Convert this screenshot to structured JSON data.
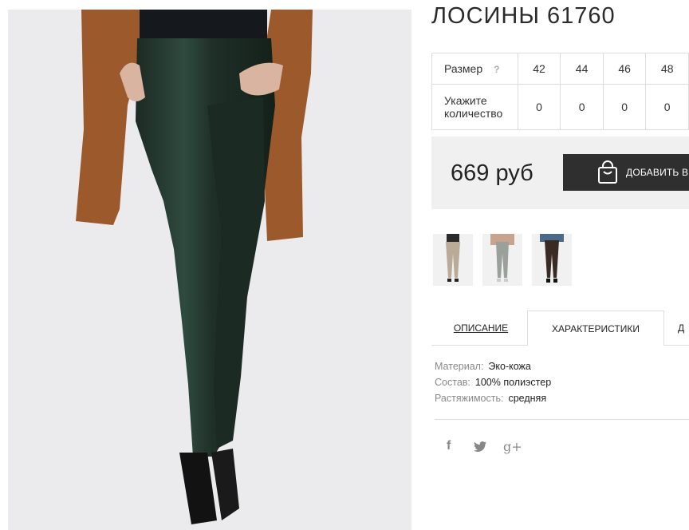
{
  "product": {
    "title": "ЛОСИНЫ 61760"
  },
  "sizes_table": {
    "size_label": "Размер",
    "help": "?",
    "quantity_label_1": "Укажите",
    "quantity_label_2": "количество",
    "sizes": [
      "42",
      "44",
      "46",
      "48"
    ],
    "quantities": [
      "0",
      "0",
      "0",
      "0"
    ]
  },
  "price": {
    "value": "669 руб",
    "add_button": "ДОБАВИТЬ В"
  },
  "thumbnails": [
    {
      "name": "beige",
      "color": "#b9ab97"
    },
    {
      "name": "grey",
      "color": "#9aa09a"
    },
    {
      "name": "brown",
      "color": "#3a2a24"
    }
  ],
  "tabs": {
    "description": "ОПИСАНИЕ",
    "characteristics": "ХАРАКТЕРИСТИКИ",
    "third": "Д"
  },
  "specs": {
    "material_key": "Материал:",
    "material_val": "Эко-кожа",
    "composition_key": "Состав:",
    "composition_val": "100% полиэстер",
    "stretch_key": "Растяжимость:",
    "stretch_val": "средняя"
  },
  "social": {
    "facebook": "f",
    "twitter": "twitter",
    "gplus": "g+"
  }
}
